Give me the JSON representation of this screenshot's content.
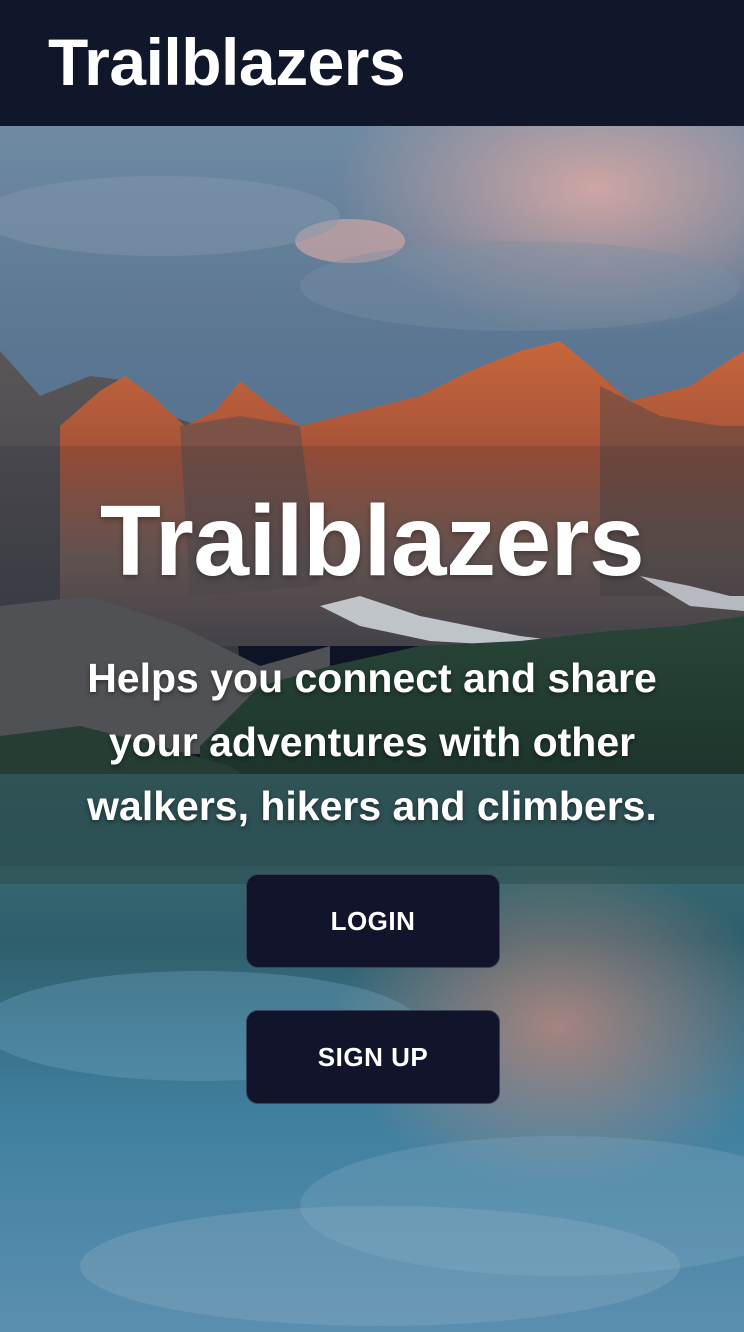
{
  "navbar": {
    "brand": "Trailblazers"
  },
  "hero": {
    "title": "Trailblazers",
    "tagline": "Helps you connect and share your adventures with other walkers, hikers and climbers.",
    "background": "mountain-lake-landscape"
  },
  "buttons": {
    "login_label": "LOGIN",
    "signup_label": "SIGN UP"
  },
  "colors": {
    "navbar_bg": "#11172a",
    "button_bg": "#11142a",
    "text": "#ffffff"
  }
}
